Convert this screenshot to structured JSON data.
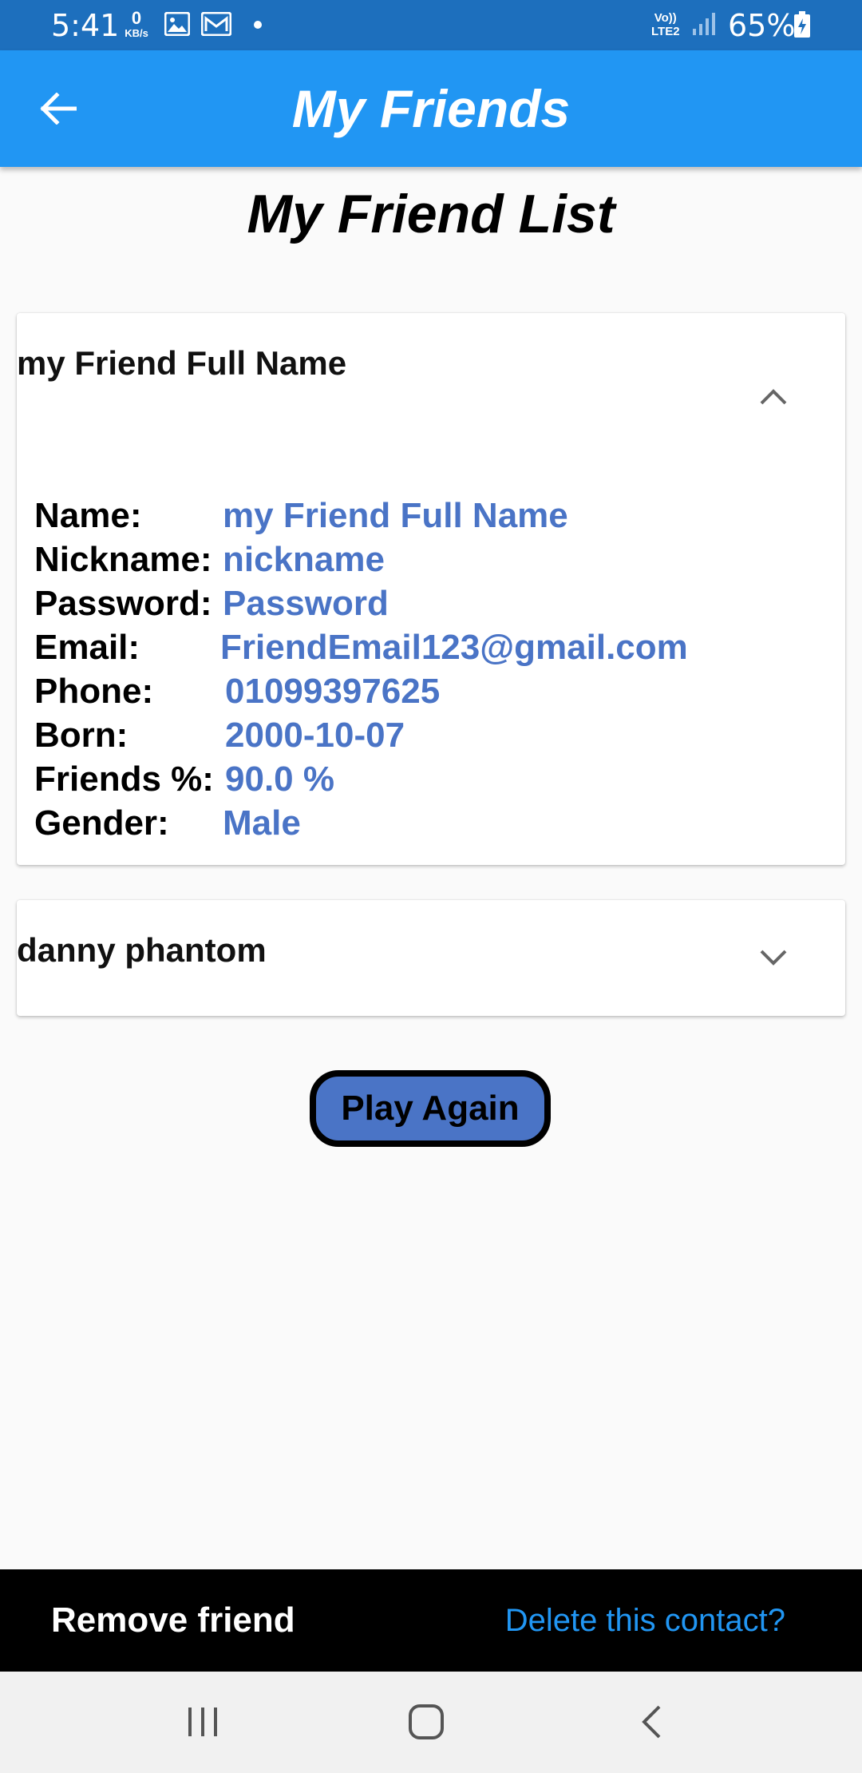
{
  "status_bar": {
    "time": "5:41",
    "net_speed_value": "0",
    "net_speed_unit": "KB/s",
    "network_label_top": "Vo))",
    "network_label_bottom": "LTE2",
    "battery_percent": "65%",
    "icons": [
      "gallery-icon",
      "gmail-icon",
      "notification-dot-icon",
      "signal-icon",
      "battery-charging-icon"
    ]
  },
  "app_bar": {
    "title": "My Friends",
    "back_icon": "arrow-left-icon"
  },
  "page": {
    "heading": "My Friend List"
  },
  "friends": [
    {
      "title": "my Friend Full Name",
      "expanded": true,
      "chevron_icon": "chevron-up-icon",
      "details": [
        {
          "label": "Name:",
          "value": "my Friend Full Name"
        },
        {
          "label": "Nickname:",
          "value": "nickname"
        },
        {
          "label": "Password:",
          "value": "Password"
        },
        {
          "label": "Email:",
          "value": "FriendEmail123@gmail.com"
        },
        {
          "label": "Phone:",
          "value": "01099397625"
        },
        {
          "label": "Born:",
          "value": "2000-10-07"
        },
        {
          "label": "Friends %:",
          "value": "90.0 %"
        },
        {
          "label": "Gender:",
          "value": "Male"
        }
      ]
    },
    {
      "title": "danny phantom",
      "expanded": false,
      "chevron_icon": "chevron-down-icon"
    }
  ],
  "play_again_label": "Play Again",
  "snackbar": {
    "message": "Remove friend",
    "action": "Delete this contact?"
  },
  "nav_bar": {
    "icons": [
      "recents-icon",
      "home-icon",
      "back-icon"
    ]
  },
  "colors": {
    "status_bar": "#1d6fbd",
    "app_bar": "#2196f3",
    "detail_value": "#4a74c6",
    "button_fill": "#4a74c6",
    "snackbar_bg": "#000000",
    "snackbar_action": "#2196f3",
    "background": "#fafafa"
  }
}
